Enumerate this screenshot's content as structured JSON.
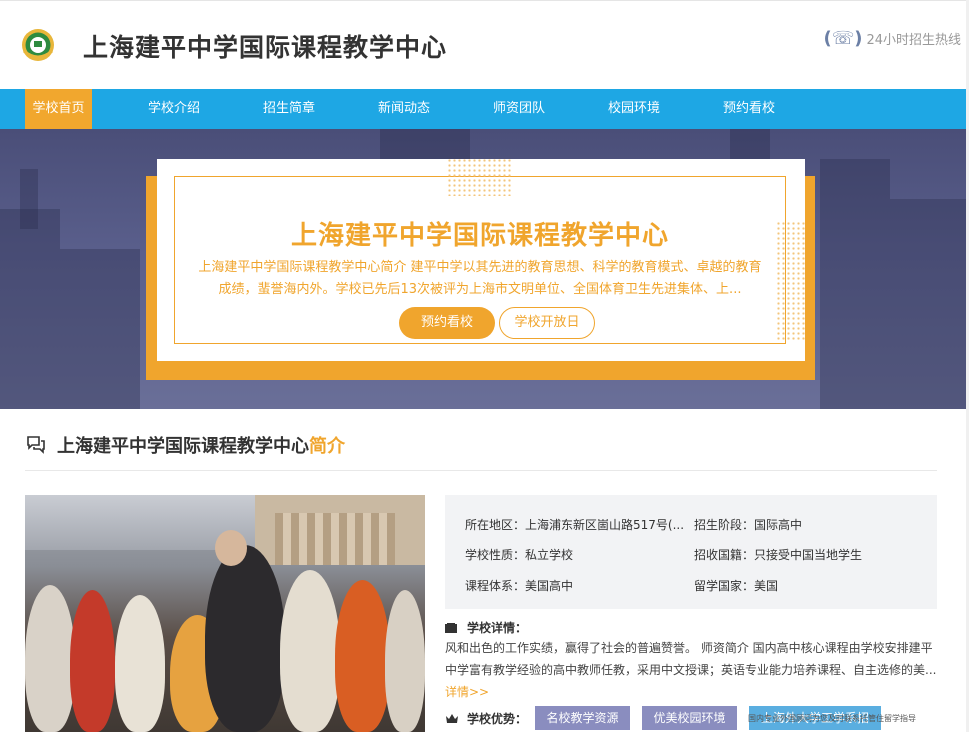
{
  "header": {
    "title": "上海建平中学国际课程教学中心",
    "hotline_label": "24小时招生热线",
    "phone_icon": "phone-icon"
  },
  "nav": {
    "items": [
      {
        "label": "学校首页",
        "active": true
      },
      {
        "label": "学校介绍"
      },
      {
        "label": "招生简章"
      },
      {
        "label": "新闻动态"
      },
      {
        "label": "师资团队"
      },
      {
        "label": "校园环境"
      },
      {
        "label": "预约看校"
      }
    ]
  },
  "banner": {
    "title": "上海建平中学国际课程教学中心",
    "description": "上海建平中学国际课程教学中心简介 建平中学以其先进的教育思想、科学的教育模式、卓越的教育成绩，蜚誉海内外。学校已先后13次被评为上海市文明单位、全国体育卫生先进集体、上...",
    "btn_visit": "预约看校",
    "btn_open_day": "学校开放日"
  },
  "intro": {
    "title_main": "上海建平中学国际课程教学中心",
    "title_accent": "简介",
    "info": {
      "location_label": "所在地区：",
      "location_value": "上海浦东新区崮山路517号(...",
      "stage_label": "招生阶段：",
      "stage_value": "国际高中",
      "nature_label": "学校性质：",
      "nature_value": "私立学校",
      "nationality_label": "招收国籍：",
      "nationality_value": "只接受中国当地学生",
      "curriculum_label": "课程体系：",
      "curriculum_value": "美国高中",
      "country_label": "留学国家：",
      "country_value": "美国"
    },
    "detail_label": "学校详情：",
    "detail_text": "风和出色的工作实绩，赢得了社会的普遍赞誉。 师资简介 国内高中核心课程由学校安排建平中学富有教学经验的高中教师任教，采用中文授课；英语专业能力培养课程、自主选修的美...",
    "more_link": "详情>>",
    "advantage_label": "学校优势：",
    "tags": [
      "名校教学资源",
      "优美校园环境",
      "上海外大学工学系招"
    ],
    "float_note": "国内专业外国顾问为您及时联系托管住留学指导"
  },
  "colors": {
    "accent": "#f0a52d",
    "nav_blue": "#1ea7e4",
    "tag_purple": "#8a8dbf",
    "tag_blue": "#5aaee0"
  }
}
